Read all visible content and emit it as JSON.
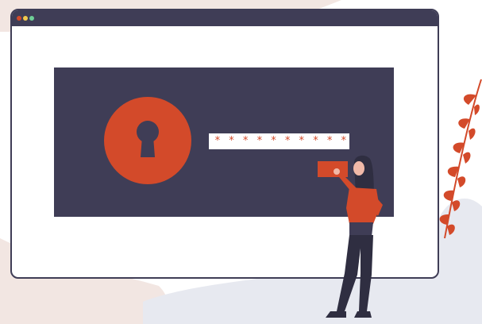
{
  "password_field": {
    "masked_value": "* * * * * * * * * * *"
  },
  "window_controls": [
    "close",
    "minimize",
    "maximize"
  ],
  "icons": {
    "lock": "keyhole-icon",
    "plant": "leaf-branch-icon",
    "person": "person-figure"
  },
  "colors": {
    "accent": "#d34a2a",
    "panel": "#3f3d56",
    "window_bg": "#ffffff",
    "blob_pink": "#f2e6e2",
    "blob_gray": "#e7e9f0"
  }
}
